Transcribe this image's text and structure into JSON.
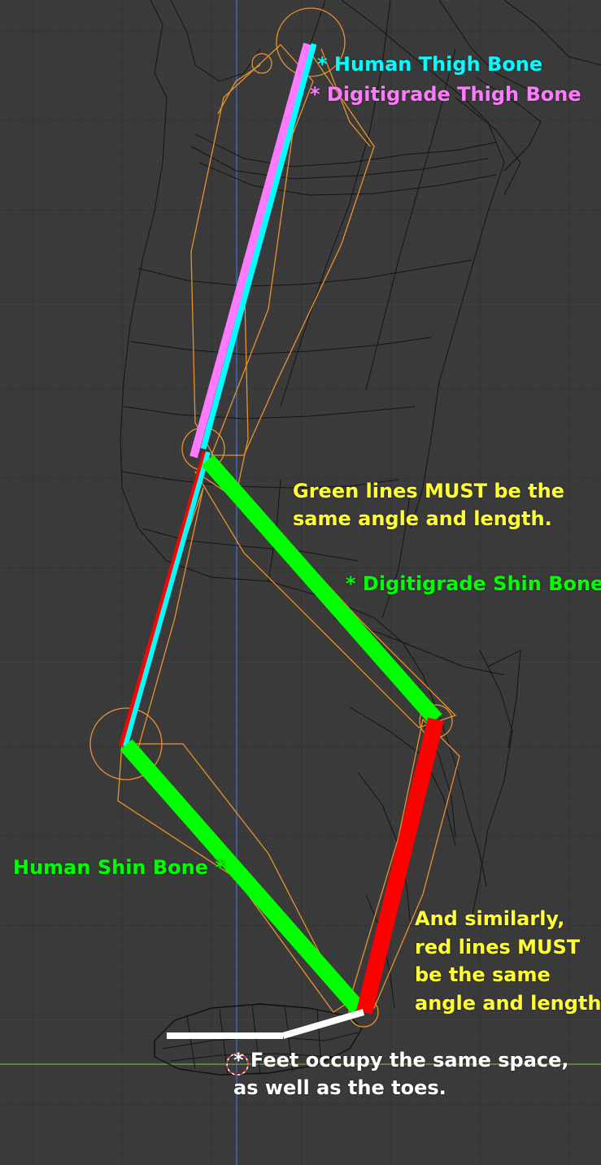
{
  "colors": {
    "background": "#3a3a3a",
    "grid_minor": "#424242",
    "grid_major": "#2e2e2e",
    "wire": "#141414",
    "rig": "#e8922e",
    "axis_vertical": "#3f6cc7",
    "axis_horizontal": "#6e9a3a",
    "cyan": "#00ffff",
    "pink": "#ff7aff",
    "green": "#00ff00",
    "red": "#ff0000",
    "white": "#ffffff",
    "yellow": "#ffff33"
  },
  "icons": [
    "joint-circle-icon",
    "origin-marker-icon"
  ],
  "annotations": {
    "human_thigh": "* Human Thigh Bone",
    "digi_thigh": "* Digitigrade Thigh Bone",
    "green_note_1": "Green lines MUST be the",
    "green_note_2": "same angle and length.",
    "digi_shin": "* Digitigrade Shin Bone",
    "human_shin": "Human Shin Bone *",
    "red_note_1": "And similarly,",
    "red_note_2": "red lines MUST",
    "red_note_3": "be the same",
    "red_note_4": "angle and length",
    "feet_note_1": "* Feet occupy the same space,",
    "feet_note_2": "as well as the toes."
  }
}
